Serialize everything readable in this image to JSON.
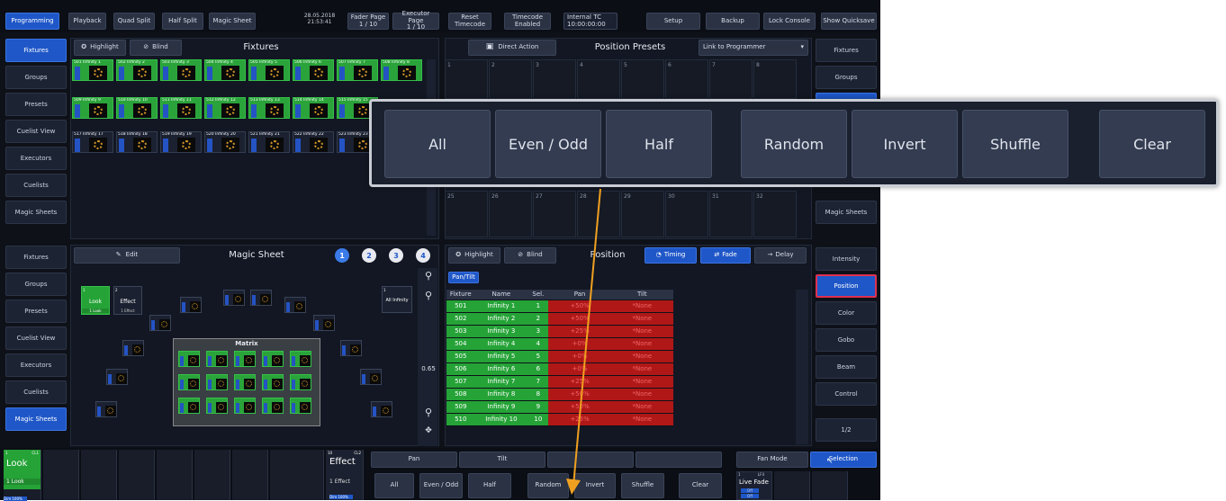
{
  "topbar": {
    "programming": "Programming",
    "playback": "Playback",
    "quad_split": "Quad Split",
    "half_split": "Half Split",
    "magic_sheet": "Magic Sheet",
    "date": "28.05.2018",
    "time": "21:53:41",
    "fader_page_label": "Fader Page",
    "fader_page_value": "1 / 10",
    "executor_page_label": "Executor Page",
    "executor_page_value": "1 / 10",
    "reset_timecode_1": "Reset",
    "reset_timecode_2": "Timecode",
    "timecode_1": "Timecode",
    "timecode_2": "Enabled",
    "internal_tc_1": "Internal TC",
    "internal_tc_2": "10:00:00:00",
    "setup": "Setup",
    "backup": "Backup",
    "lock_console": "Lock Console",
    "show_quicksave": "Show Quicksave"
  },
  "left_sidebar_top": [
    "Fixtures",
    "Groups",
    "Presets",
    "Cuelist View",
    "Executors",
    "Cuelists",
    "Magic Sheets"
  ],
  "left_sidebar_bottom": [
    "Fixtures",
    "Groups",
    "Presets",
    "Cuelist View",
    "Executors",
    "Cuelists",
    "Magic Sheets"
  ],
  "right_sidebar_top": [
    "Fixtures",
    "Groups",
    "",
    "",
    "",
    "",
    "Magic Sheets"
  ],
  "right_sidebar_bottom": [
    "Intensity",
    "Position",
    "Color",
    "Gobo",
    "Beam",
    "Control",
    "1/2"
  ],
  "fixtures_panel": {
    "title": "Fixtures",
    "highlight": "Highlight",
    "blind": "Blind",
    "rows": [
      [
        "501 Infinity 1",
        "502 Infinity 2",
        "503 Infinity 3",
        "504 Infinity 4",
        "505 Infinity 5",
        "506 Infinity 6",
        "507 Infinity 7",
        "508 Infinity 8"
      ],
      [
        "509 Infinity 9",
        "510 Infinity 10",
        "511 Infinity 11",
        "512 Infinity 12",
        "513 Infinity 13",
        "514 Infinity 14",
        "515 Infinity 15",
        ""
      ],
      [
        "517 Infinity 17",
        "518 Infinity 18",
        "519 Infinity 19",
        "520 Infinity 20",
        "521 Infinity 21",
        "522 Infinity 22",
        "523 Infinity 23",
        ""
      ]
    ]
  },
  "position_presets": {
    "direct_action": "Direct Action",
    "title": "Position Presets",
    "link": "Link to Programmer",
    "numbers_top": [
      "1",
      "2",
      "3",
      "4",
      "5",
      "6",
      "7",
      "8"
    ],
    "numbers_bottom": [
      "25",
      "26",
      "27",
      "28",
      "29",
      "30",
      "31",
      "32"
    ]
  },
  "popup": {
    "all": "All",
    "even_odd": "Even / Odd",
    "half": "Half",
    "random": "Random",
    "invert": "Invert",
    "shuffle": "Shuffle",
    "clear": "Clear"
  },
  "magic_sheet": {
    "edit": "Edit",
    "title": "Magic Sheet",
    "badges": [
      "1",
      "2",
      "3",
      "4"
    ],
    "look_num": "1",
    "look_label": "Look",
    "look_sub": "1 Look",
    "effect_num": "2",
    "effect_label": "Effect",
    "effect_sub": "1 Effect",
    "all_infinity_num": "1",
    "all_infinity": "All Infinity",
    "matrix": "Matrix",
    "fader_value": "0.65"
  },
  "position_panel": {
    "highlight": "Highlight",
    "blind": "Blind",
    "title": "Position",
    "timing": "Timing",
    "fade": "Fade",
    "delay": "Delay",
    "pan_tilt": "Pan/Tilt",
    "headers": [
      "Fixture",
      "Name",
      "Sel.",
      "Pan",
      "Tilt"
    ],
    "rows": [
      [
        "501",
        "Infinity 1",
        "1",
        "+50%",
        "*None"
      ],
      [
        "502",
        "Infinity 2",
        "2",
        "+50%",
        "*None"
      ],
      [
        "503",
        "Infinity 3",
        "3",
        "+25%",
        "*None"
      ],
      [
        "504",
        "Infinity 4",
        "4",
        "+0%",
        "*None"
      ],
      [
        "505",
        "Infinity 5",
        "5",
        "+0%",
        "*None"
      ],
      [
        "506",
        "Infinity 6",
        "6",
        "+0%",
        "*None"
      ],
      [
        "507",
        "Infinity 7",
        "7",
        "+25%",
        "*None"
      ],
      [
        "508",
        "Infinity 8",
        "8",
        "+50%",
        "*None"
      ],
      [
        "509",
        "Infinity 9",
        "9",
        "+50%",
        "*None"
      ],
      [
        "510",
        "Infinity 10",
        "10",
        "+25%",
        "*None"
      ]
    ]
  },
  "bottom": {
    "exec1_num": "1",
    "exec1_cl": "CL1",
    "exec1_label": "Look",
    "exec1_sub": "1 Look",
    "exec1_dim": "Dim 100%",
    "exec10_num": "10",
    "exec10_cl": "CL2",
    "exec10_label": "Effect",
    "exec10_sub": "1 Effect",
    "exec10_dim": "Dim 100%",
    "pan": "Pan",
    "tilt": "Tilt",
    "fan_mode": "Fan Mode",
    "selection": "Selection",
    "buttons": [
      "All",
      "Even / Odd",
      "Half",
      "Random",
      "Invert",
      "Shuffle",
      "Clear"
    ],
    "live_fade_num": "1",
    "live_fade_lf": "LF4",
    "live_fade": "Live Fade",
    "live_fade_off1": "Off",
    "live_fade_off2": "Off"
  },
  "colors": {
    "accent_blue": "#1f57c8",
    "selected_green": "#25a337",
    "value_red": "#b01818",
    "annotation_orange": "#f0a020"
  }
}
